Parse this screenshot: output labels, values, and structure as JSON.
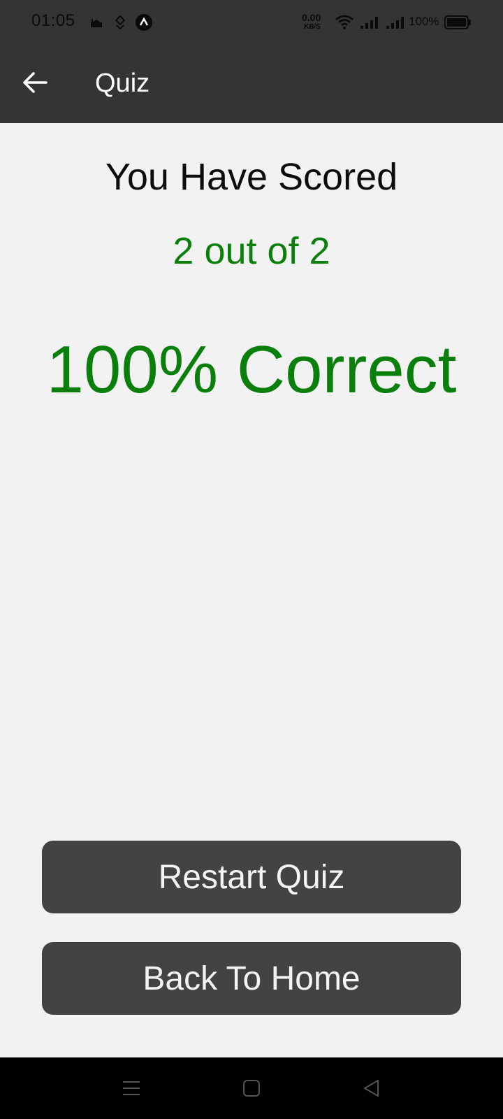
{
  "status_bar": {
    "time": "01:05",
    "net_speed_value": "0.00",
    "net_speed_unit": "KB/S",
    "battery": "100%",
    "icons": [
      "mosque-icon",
      "location-diamond-icon",
      "nav-a-icon",
      "wifi-icon",
      "signal-icon",
      "signal-icon",
      "battery-icon"
    ]
  },
  "app_bar": {
    "title": "Quiz",
    "back_icon": "arrow-left-icon"
  },
  "result": {
    "heading": "You Have Scored",
    "score": "2 out of 2",
    "percent": "100% Correct"
  },
  "actions": {
    "restart_label": "Restart Quiz",
    "home_label": "Back To Home"
  },
  "nav_bar": {
    "icons": [
      "menu-icon",
      "home-square-icon",
      "back-triangle-icon"
    ]
  },
  "colors": {
    "bar": "#343434",
    "background": "#f2f2f2",
    "accent_green": "#0b7f0b",
    "button": "#434343"
  }
}
